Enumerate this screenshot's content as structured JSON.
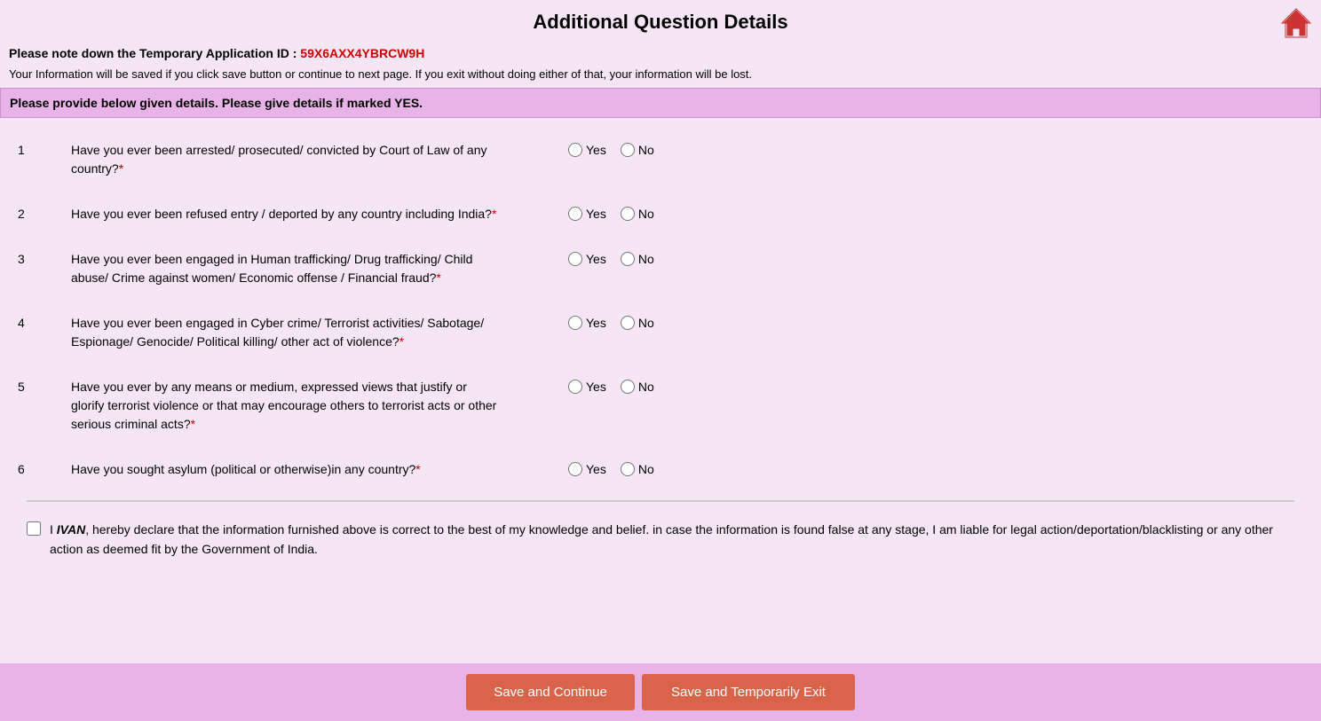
{
  "header": {
    "title": "Additional Question Details",
    "home_icon": "home"
  },
  "temp_id": {
    "label": "Please note down the Temporary Application ID :",
    "value": "59X6AXX4YBRCW9H"
  },
  "info_text": "Your Information will be saved if you click save button or continue to next page. If you exit without doing either of that, your information will be lost.",
  "notice": "Please provide below given details. Please give details if marked YES.",
  "questions": [
    {
      "number": "1",
      "text": "Have you ever been arrested/ prosecuted/ convicted by Court of Law of any country?",
      "required": true
    },
    {
      "number": "2",
      "text": "Have you ever been refused entry / deported by any country including India?",
      "required": true
    },
    {
      "number": "3",
      "text": "Have you ever been engaged in Human trafficking/ Drug trafficking/ Child abuse/ Crime against women/ Economic offense / Financial fraud?",
      "required": true
    },
    {
      "number": "4",
      "text": "Have you ever been engaged in Cyber crime/ Terrorist activities/ Sabotage/ Espionage/ Genocide/ Political killing/ other act of violence?",
      "required": true
    },
    {
      "number": "5",
      "text": "Have you ever by any means or medium, expressed views that justify or glorify terrorist violence or that may encourage others to terrorist acts or other serious criminal acts?",
      "required": true
    },
    {
      "number": "6",
      "text": "Have you sought asylum (political or otherwise)in any country?",
      "required": true
    }
  ],
  "declaration": {
    "name": "IVAN",
    "text_before": "I ",
    "text_after": ", hereby declare that the information furnished above is correct to the best of my knowledge and belief. in case the information is found false at any stage, I am liable for legal action/deportation/blacklisting or any other action as deemed fit by the Government of India."
  },
  "buttons": {
    "save_continue": "Save and Continue",
    "save_exit": "Save and Temporarily Exit"
  },
  "radio_labels": {
    "yes": "Yes",
    "no": "No"
  }
}
